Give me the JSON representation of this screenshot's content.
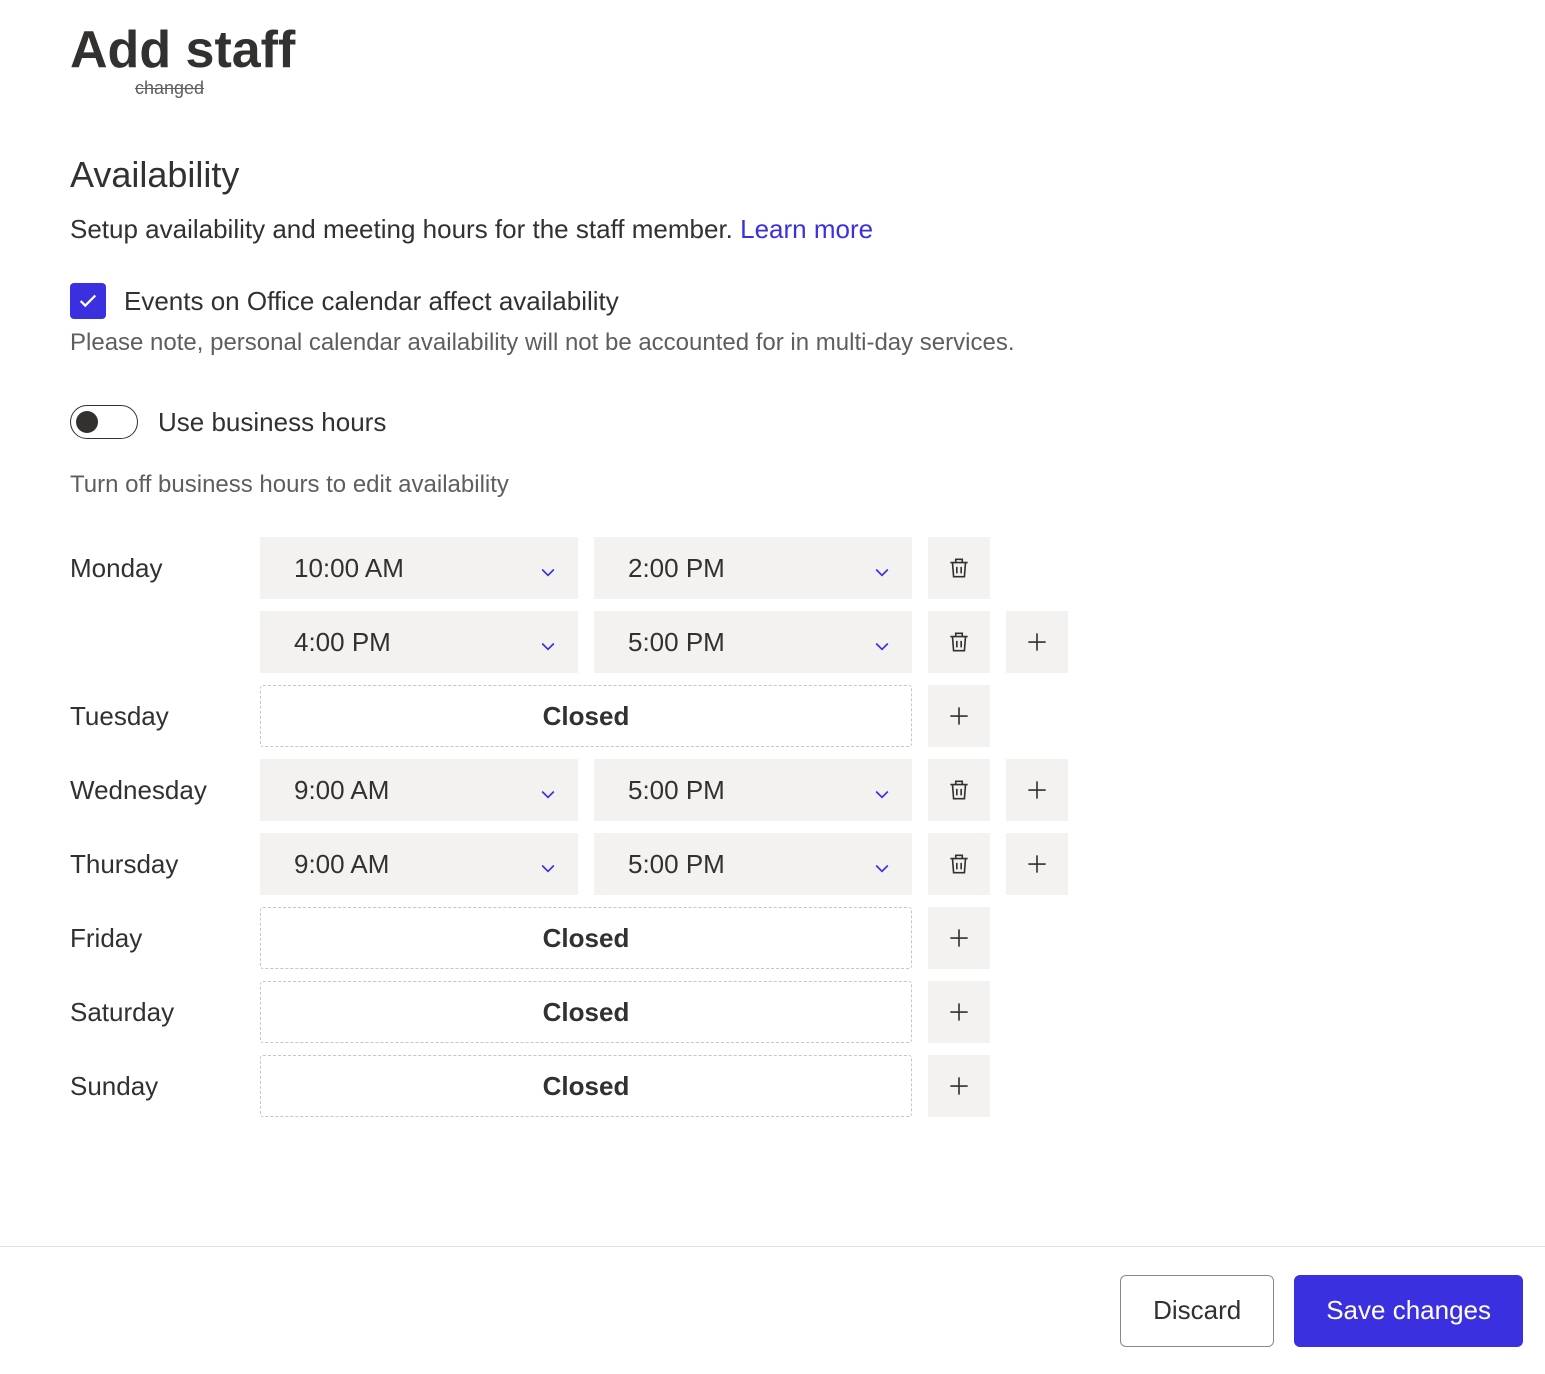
{
  "page_title": "Add staff",
  "truncated_word": "changed",
  "section": {
    "heading": "Availability",
    "description": "Setup availability and meeting hours for the staff member.",
    "learn_more": "Learn more"
  },
  "office_calendar": {
    "label": "Events on Office calendar affect availability",
    "note": "Please note, personal calendar availability will not be accounted for in multi-day services.",
    "checked": true
  },
  "business_hours": {
    "label": "Use business hours",
    "note": "Turn off business hours to edit availability",
    "enabled": false
  },
  "closed_label": "Closed",
  "schedule": {
    "monday": {
      "label": "Monday",
      "slots": [
        {
          "start": "10:00 AM",
          "end": "2:00 PM"
        },
        {
          "start": "4:00 PM",
          "end": "5:00 PM"
        }
      ]
    },
    "tuesday": {
      "label": "Tuesday",
      "closed": true
    },
    "wednesday": {
      "label": "Wednesday",
      "slots": [
        {
          "start": "9:00 AM",
          "end": "5:00 PM"
        }
      ]
    },
    "thursday": {
      "label": "Thursday",
      "slots": [
        {
          "start": "9:00 AM",
          "end": "5:00 PM"
        }
      ]
    },
    "friday": {
      "label": "Friday",
      "closed": true
    },
    "saturday": {
      "label": "Saturday",
      "closed": true
    },
    "sunday": {
      "label": "Sunday",
      "closed": true
    }
  },
  "footer": {
    "discard": "Discard",
    "save": "Save changes"
  }
}
